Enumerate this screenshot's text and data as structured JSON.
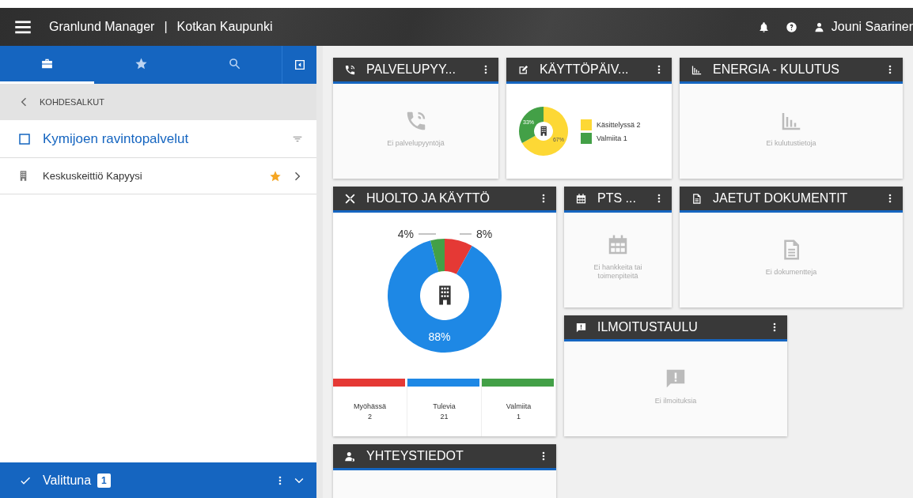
{
  "app_bar": {
    "title": "Granlund Manager",
    "separator": "|",
    "organization": "Kotkan Kaupunki",
    "user": "Jouni Saariner"
  },
  "sidebar": {
    "tabs": [
      {
        "selected": true
      },
      {
        "selected": false
      },
      {
        "selected": false
      }
    ],
    "breadcrumb": "KOHDESALKUT",
    "group": {
      "label": "Kymijoen ravintopalvelut",
      "checked": false
    },
    "items": [
      {
        "label": "Keskuskeittiö Kapyysi",
        "favorite": true
      }
    ],
    "selection_bar": {
      "label": "Valittuna",
      "count": "1"
    }
  },
  "widgets": [
    {
      "kind": "empty",
      "title": "PALVELUPYY...",
      "message": "Ei palvelupyyntöjä"
    },
    {
      "kind": "donut",
      "title": "KÄYTTÖPÄIV...",
      "chart_data": {
        "type": "donut",
        "values": [
          67,
          33
        ],
        "value_labels": [
          "67%",
          "33%"
        ]
      },
      "legend": [
        {
          "label": "Käsittelyssä 2",
          "color": "#fdd835"
        },
        {
          "label": "Valmiita 1",
          "color": "#43a047"
        }
      ]
    },
    {
      "kind": "empty",
      "title": "ENERGIA - KULUTUS",
      "message": "Ei kulutustietoja"
    },
    {
      "kind": "maintenance",
      "title": "HUOLTO JA KÄYTTÖ",
      "chart_data": {
        "type": "donut",
        "values": [
          8,
          88,
          4
        ],
        "value_labels": [
          "8%",
          "88%",
          "4%"
        ]
      },
      "stats": [
        {
          "label": "Myöhässä",
          "count": "2",
          "color": "#e53935"
        },
        {
          "label": "Tulevia",
          "count": "21",
          "color": "#1e88e5"
        },
        {
          "label": "Valmiita",
          "count": "1",
          "color": "#43a047"
        }
      ]
    },
    {
      "kind": "empty",
      "title": "PTS ...",
      "message": "Ei hankkeita tai toimenpiteitä"
    },
    {
      "kind": "empty",
      "title": "JAETUT DOKUMENTIT",
      "message": "Ei dokumentteja"
    },
    {
      "kind": "empty",
      "title": "ILMOITUSTAULU",
      "message": "Ei ilmoituksia"
    },
    {
      "kind": "blank",
      "title": "YHTEYSTIEDOT"
    }
  ]
}
